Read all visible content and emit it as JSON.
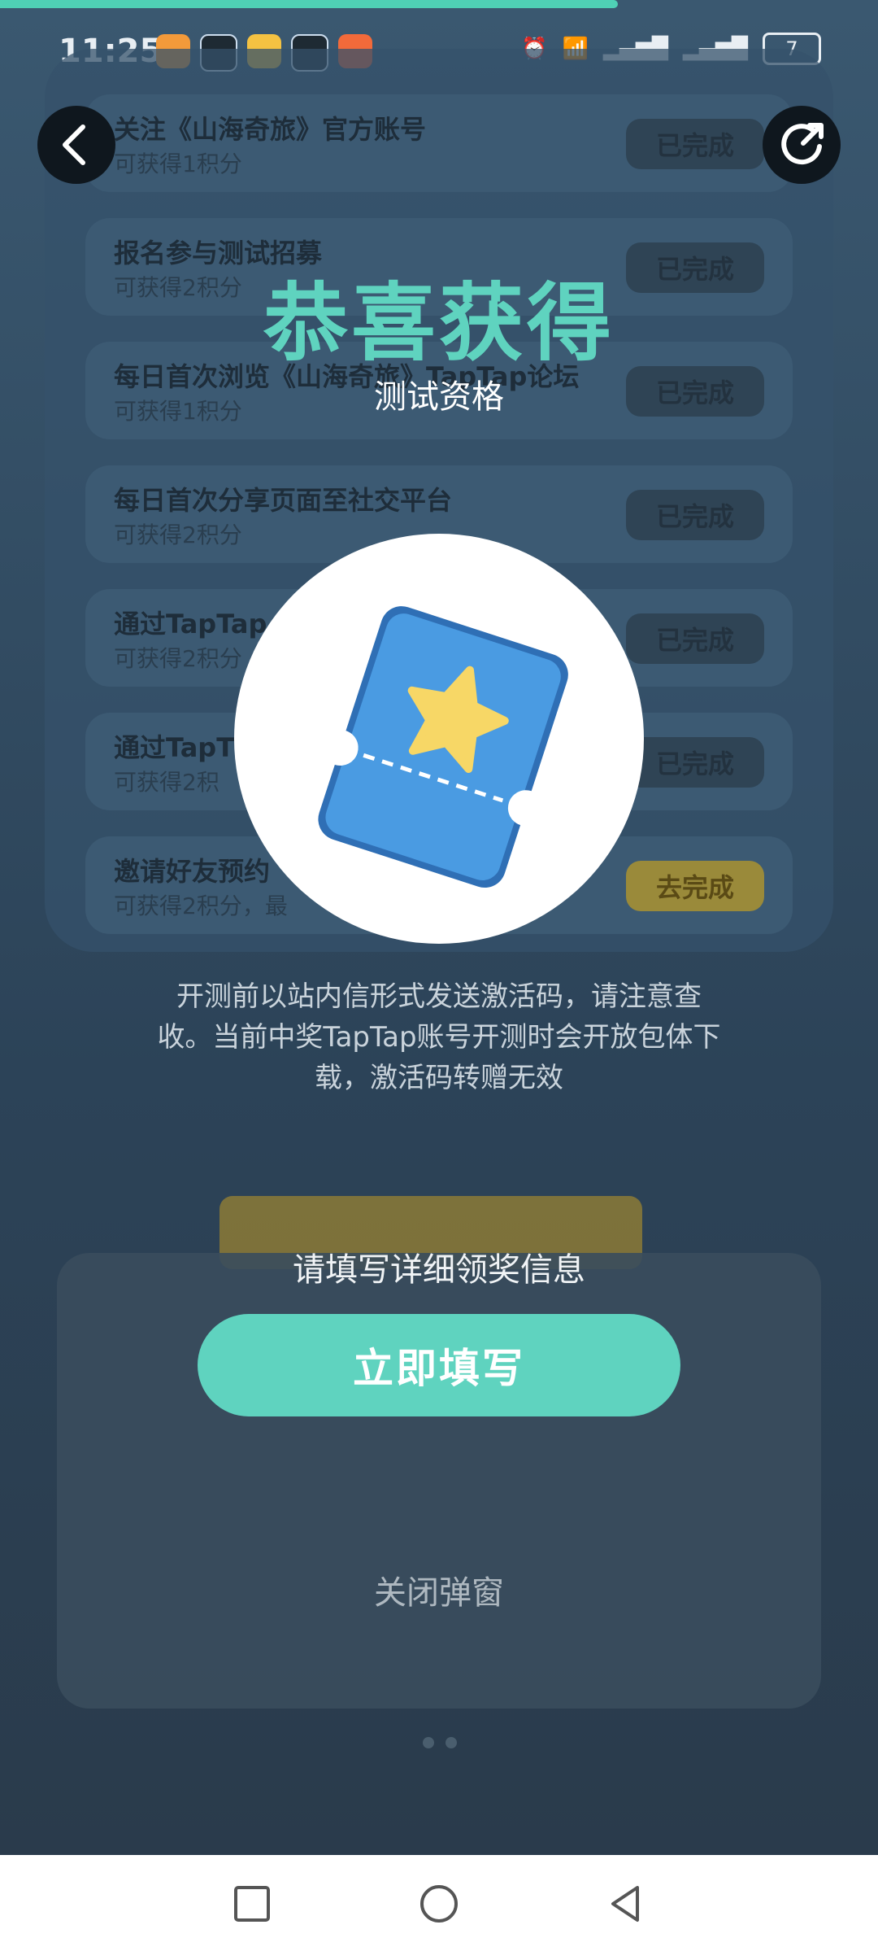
{
  "status_bar": {
    "time": "11:25",
    "battery": "7"
  },
  "tasks": [
    {
      "title": "关注《山海奇旅》官方账号",
      "sub": "可获得1积分",
      "button": "已完成"
    },
    {
      "title": "报名参与测试招募",
      "sub": "可获得2积分",
      "button": "已完成"
    },
    {
      "title": "每日首次浏览《山海奇旅》TapTap论坛",
      "sub": "可获得1积分",
      "button": "已完成"
    },
    {
      "title": "每日首次分享页面至社交平台",
      "sub": "可获得2积分",
      "button": "已完成"
    },
    {
      "title": "通过TapTap",
      "sub": "可获得2积分",
      "button": "已完成"
    },
    {
      "title": "通过TapT",
      "sub": "可获得2积",
      "button": "已完成"
    },
    {
      "title": "邀请好友预约",
      "sub": "可获得2积分，最",
      "button": "去完成"
    }
  ],
  "modal": {
    "title": "恭喜获得",
    "subtitle": "测试资格",
    "description": "开测前以站内信形式发送激活码，请注意查收。当前中奖TapTap账号开测时会开放包体下载，激活码转赠无效",
    "prompt": "请填写详细领奖信息",
    "fill_button": "立即填写",
    "close_label": "关闭弹窗"
  },
  "colors": {
    "accent": "#5fd3bf",
    "ticket_blue": "#3f8fd8",
    "star": "#f7d766"
  }
}
